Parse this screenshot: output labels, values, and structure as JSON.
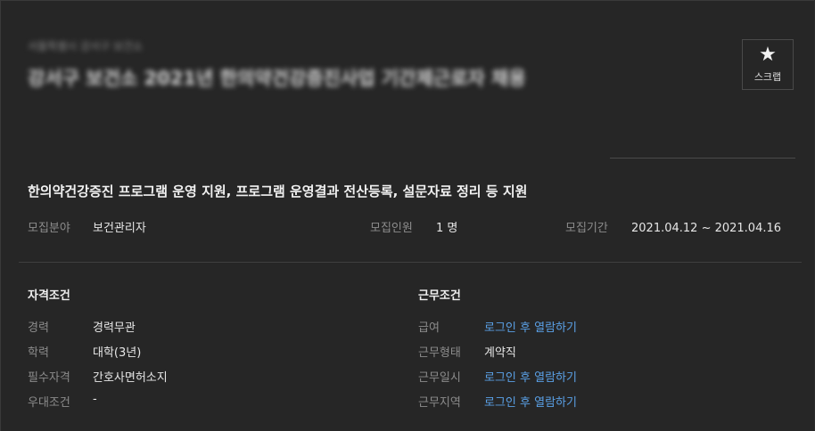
{
  "job": {
    "company": "서울특별시 강서구 보건소",
    "title": "강서구 보건소 2021년 한의약건강증진사업 기간제근로자 채용",
    "scrap_label": "스크랩",
    "headline": "한의약건강증진 프로그램 운영 지원, 프로그램 운영결과 전산등록, 설문자료 정리 등 지원",
    "field_label": "모집분야",
    "field_value": "보건관리자",
    "headcount_label": "모집인원",
    "headcount_value": "1 명",
    "period_label": "모집기간",
    "period_value": "2021.04.12 ~ 2021.04.16"
  },
  "qualifications": {
    "title": "자격조건",
    "rows": [
      {
        "label": "경력",
        "value": "경력무관"
      },
      {
        "label": "학력",
        "value": "대학(3년)"
      },
      {
        "label": "필수자격",
        "value": "간호사면허소지"
      },
      {
        "label": "우대조건",
        "value": "-"
      }
    ]
  },
  "conditions": {
    "title": "근무조건",
    "rows": [
      {
        "label": "급여",
        "value": "로그인 후 열람하기"
      },
      {
        "label": "근무형태",
        "value": "계약직"
      },
      {
        "label": "근무일시",
        "value": "로그인 후 열람하기"
      },
      {
        "label": "근무지역",
        "value": "로그인 후 열람하기"
      }
    ]
  },
  "colors": {
    "link": "#5aa0e6",
    "background": "#262626",
    "muted": "#8c8c8c"
  },
  "icons": {
    "scrap": "star-icon"
  }
}
